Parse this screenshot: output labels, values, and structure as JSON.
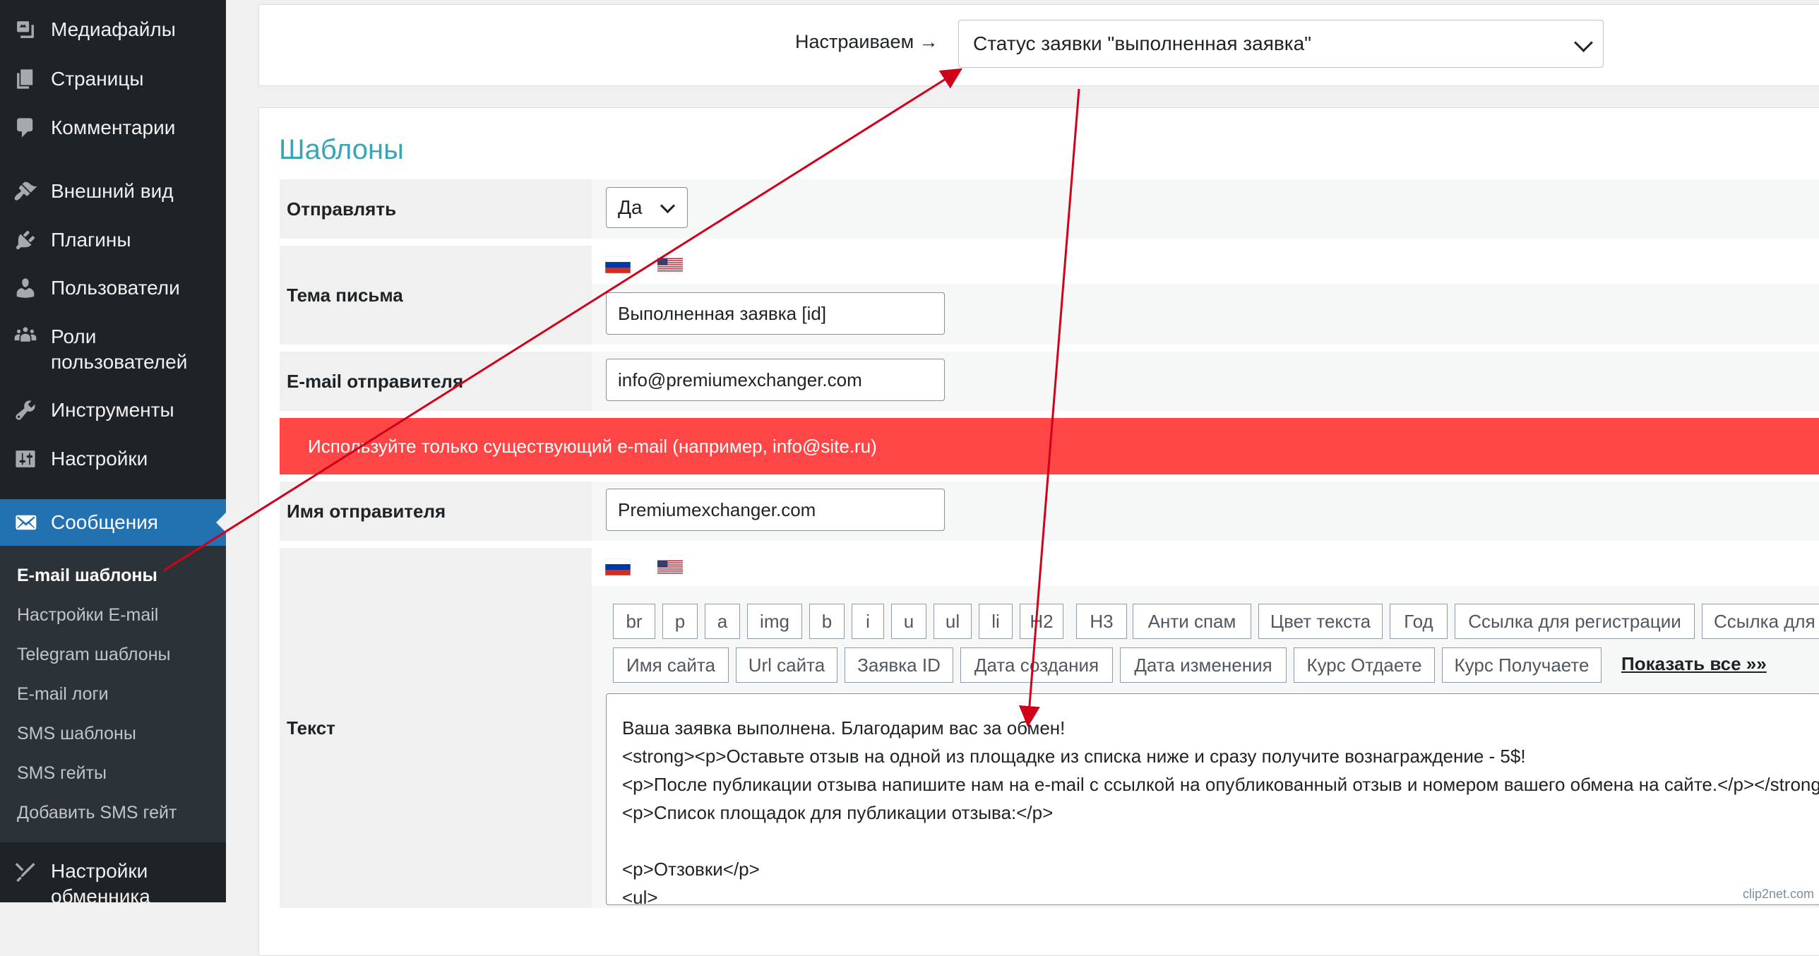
{
  "sidebar": {
    "items": [
      {
        "label": "Медиафайлы",
        "icon": "media-icon"
      },
      {
        "label": "Страницы",
        "icon": "pages-icon"
      },
      {
        "label": "Комментарии",
        "icon": "comments-icon"
      },
      {
        "label": "Внешний вид",
        "icon": "appearance-icon"
      },
      {
        "label": "Плагины",
        "icon": "plugins-icon"
      },
      {
        "label": "Пользователи",
        "icon": "users-icon"
      },
      {
        "label": "Роли пользователей",
        "icon": "roles-icon"
      },
      {
        "label": "Инструменты",
        "icon": "tools-icon"
      },
      {
        "label": "Настройки",
        "icon": "settings-icon"
      }
    ],
    "active": {
      "label": "Сообщения",
      "icon": "mail-icon"
    },
    "submenu": [
      "E-mail шаблоны",
      "Настройки E-mail",
      "Telegram шаблоны",
      "E-mail логи",
      "SMS шаблоны",
      "SMS гейты",
      "Добавить SMS гейт"
    ],
    "bottom_item": {
      "label": "Настройки обменника",
      "icon": "exchanger-settings-icon"
    }
  },
  "header": {
    "configure_label": "Настраиваем →",
    "status_select_value": "Статус заявки \"выполненная заявка\""
  },
  "templates": {
    "title": "Шаблоны",
    "send": {
      "label": "Отправлять",
      "value": "Да"
    },
    "subject": {
      "label": "Тема письма",
      "value": "Выполненная заявка [id]"
    },
    "sender_email": {
      "label": "E-mail отправителя",
      "value": "info@premiumexchanger.com"
    },
    "alert": "Используйте только существующий e-mail (например, info@site.ru)",
    "sender_name": {
      "label": "Имя отправителя",
      "value": "Premiumexchanger.com"
    },
    "text": {
      "label": "Текст",
      "tags_row1": [
        "br",
        "p",
        "a",
        "img",
        "b",
        "i",
        "u",
        "ul",
        "li",
        "H2",
        "H3",
        "Анти спам",
        "Цвет текста",
        "Год",
        "Ссылка для регистрации",
        "Ссылка для"
      ],
      "tags_row2": [
        "Имя сайта",
        "Url сайта",
        "Заявка ID",
        "Дата создания",
        "Дата изменения",
        "Курс Отдаете",
        "Курс Получаете"
      ],
      "show_all": "Показать все »»",
      "lines": [
        "Ваша заявка выполнена. Благодарим вас за обмен!",
        "<strong><p>Оставьте отзыв на одной из площадке из списка ниже и сразу получите вознаграждение - 5$!",
        "<p>После публикации отзыва напишите нам на e-mail с ссылкой на опубликованный отзыв и номером вашего обмена на сайте.</p></strong>",
        "<p>Список площадок для публикации отзыва:</p>",
        "",
        "<p>Отзовки</p>",
        "<ul>"
      ]
    }
  },
  "flags": [
    "ru-flag-icon",
    "us-flag-icon"
  ],
  "colors": {
    "accent": "#2271b1",
    "alert": "#ff4646",
    "title": "#3aa5b5",
    "arrow": "#d0021b"
  },
  "watermark": "clip2net.com"
}
